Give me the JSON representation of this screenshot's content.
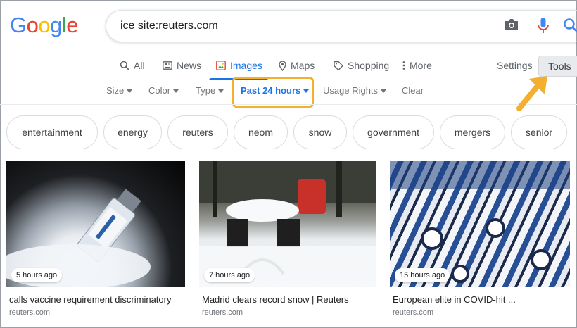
{
  "header": {
    "logo_letters": [
      {
        "ch": "G",
        "color": "#4285f4"
      },
      {
        "ch": "o",
        "color": "#ea4335"
      },
      {
        "ch": "o",
        "color": "#fbbc05"
      },
      {
        "ch": "g",
        "color": "#4285f4"
      },
      {
        "ch": "l",
        "color": "#34a853"
      },
      {
        "ch": "e",
        "color": "#ea4335"
      }
    ],
    "query": "ice site:reuters.com"
  },
  "tabs": [
    {
      "label": "All",
      "icon": "search-icon"
    },
    {
      "label": "News",
      "icon": "news-icon"
    },
    {
      "label": "Images",
      "icon": "image-icon",
      "active": true
    },
    {
      "label": "Maps",
      "icon": "map-pin-icon"
    },
    {
      "label": "Shopping",
      "icon": "tag-icon"
    },
    {
      "label": "More",
      "icon": "more-vertical-icon"
    }
  ],
  "settings_label": "Settings",
  "tools_label": "Tools",
  "filters": [
    {
      "label": "Size",
      "caret": true
    },
    {
      "label": "Color",
      "caret": true
    },
    {
      "label": "Type",
      "caret": true
    },
    {
      "label": "Past 24 hours",
      "caret": true,
      "active": true
    },
    {
      "label": "Usage Rights",
      "caret": true
    },
    {
      "label": "Clear",
      "caret": false
    }
  ],
  "chips": [
    "entertainment",
    "energy",
    "reuters",
    "neom",
    "snow",
    "government",
    "mergers",
    "senior"
  ],
  "results": [
    {
      "time": "5 hours ago",
      "caption": "calls vaccine requirement discriminatory",
      "source": "reuters.com"
    },
    {
      "time": "7 hours ago",
      "caption": "Madrid clears record snow | Reuters",
      "source": "reuters.com"
    },
    {
      "time": "15 hours ago",
      "caption": "European elite in COVID-hit ...",
      "source": "reuters.com"
    }
  ],
  "colors": {
    "accent": "#1a73e8",
    "highlight": "#f3b02f"
  }
}
